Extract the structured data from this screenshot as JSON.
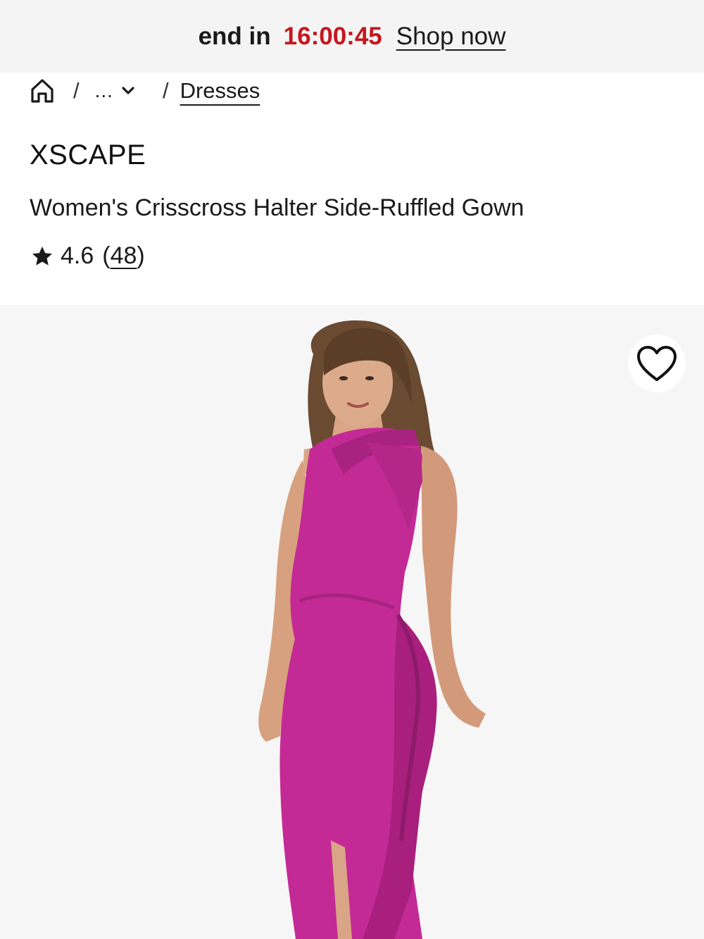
{
  "promo": {
    "text": "end in",
    "timer": "16:00:45",
    "link_label": "Shop now",
    "timer_color": "#c6161d"
  },
  "breadcrumb": {
    "home_icon": "home-icon",
    "separator": "/",
    "collapsed": "...",
    "collapsed_icon": "chevron-down-icon",
    "current": "Dresses"
  },
  "product": {
    "brand": "XSCAPE",
    "title": "Women's Crisscross Halter Side-Ruffled Gown",
    "rating": "4.6",
    "review_open": "(",
    "review_count": "48",
    "review_close": ")",
    "rating_icon": "star-icon",
    "dress_color": "#c42a95"
  },
  "image": {
    "wishlist_icon": "heart-icon"
  }
}
